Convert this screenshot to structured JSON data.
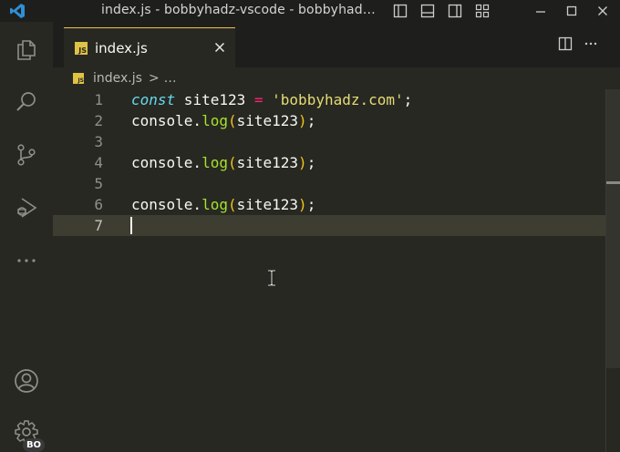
{
  "window": {
    "title": "index.js - bobbyhadz-vscode - bobbyhad…"
  },
  "tab": {
    "label": "index.js",
    "file_icon": "JS"
  },
  "breadcrumb": {
    "file": "index.js",
    "separator": ">",
    "ellipsis": "…"
  },
  "activity": {
    "account_badge": "BO"
  },
  "icons": [
    "vscode-logo-icon",
    "files-icon",
    "search-icon",
    "source-control-icon",
    "run-debug-icon",
    "more-icon",
    "account-icon",
    "settings-gear-icon",
    "split-editor-icon",
    "close-icon"
  ],
  "editor": {
    "lines": [
      {
        "n": "1",
        "tokens": [
          [
            "kw",
            "const"
          ],
          [
            "plain",
            " site123 "
          ],
          [
            "op",
            "="
          ],
          [
            "plain",
            " "
          ],
          [
            "str",
            "'bobbyhadz.com'"
          ],
          [
            "plain",
            ";"
          ]
        ]
      },
      {
        "n": "2",
        "tokens": [
          [
            "plain",
            "console."
          ],
          [
            "fn",
            "log"
          ],
          [
            "paren",
            "("
          ],
          [
            "plain",
            "site123"
          ],
          [
            "paren",
            ")"
          ],
          [
            "plain",
            ";"
          ]
        ]
      },
      {
        "n": "3",
        "tokens": []
      },
      {
        "n": "4",
        "tokens": [
          [
            "plain",
            "console."
          ],
          [
            "fn",
            "log"
          ],
          [
            "paren",
            "("
          ],
          [
            "plain",
            "site123"
          ],
          [
            "paren",
            ")"
          ],
          [
            "plain",
            ";"
          ]
        ]
      },
      {
        "n": "5",
        "tokens": []
      },
      {
        "n": "6",
        "tokens": [
          [
            "plain",
            "console."
          ],
          [
            "fn",
            "log"
          ],
          [
            "paren",
            "("
          ],
          [
            "plain",
            "site123"
          ],
          [
            "paren",
            ")"
          ],
          [
            "plain",
            ";"
          ]
        ]
      },
      {
        "n": "7",
        "tokens": []
      }
    ],
    "current_line": 7
  },
  "colors": {
    "background": "#272822",
    "titlebar": "#1e1f1c",
    "keyword": "#66d9ef",
    "operator": "#f92672",
    "string": "#e6db74",
    "function": "#a6e22e",
    "bracket": "#f0c419",
    "active_tab_border": "#f0c24a"
  }
}
